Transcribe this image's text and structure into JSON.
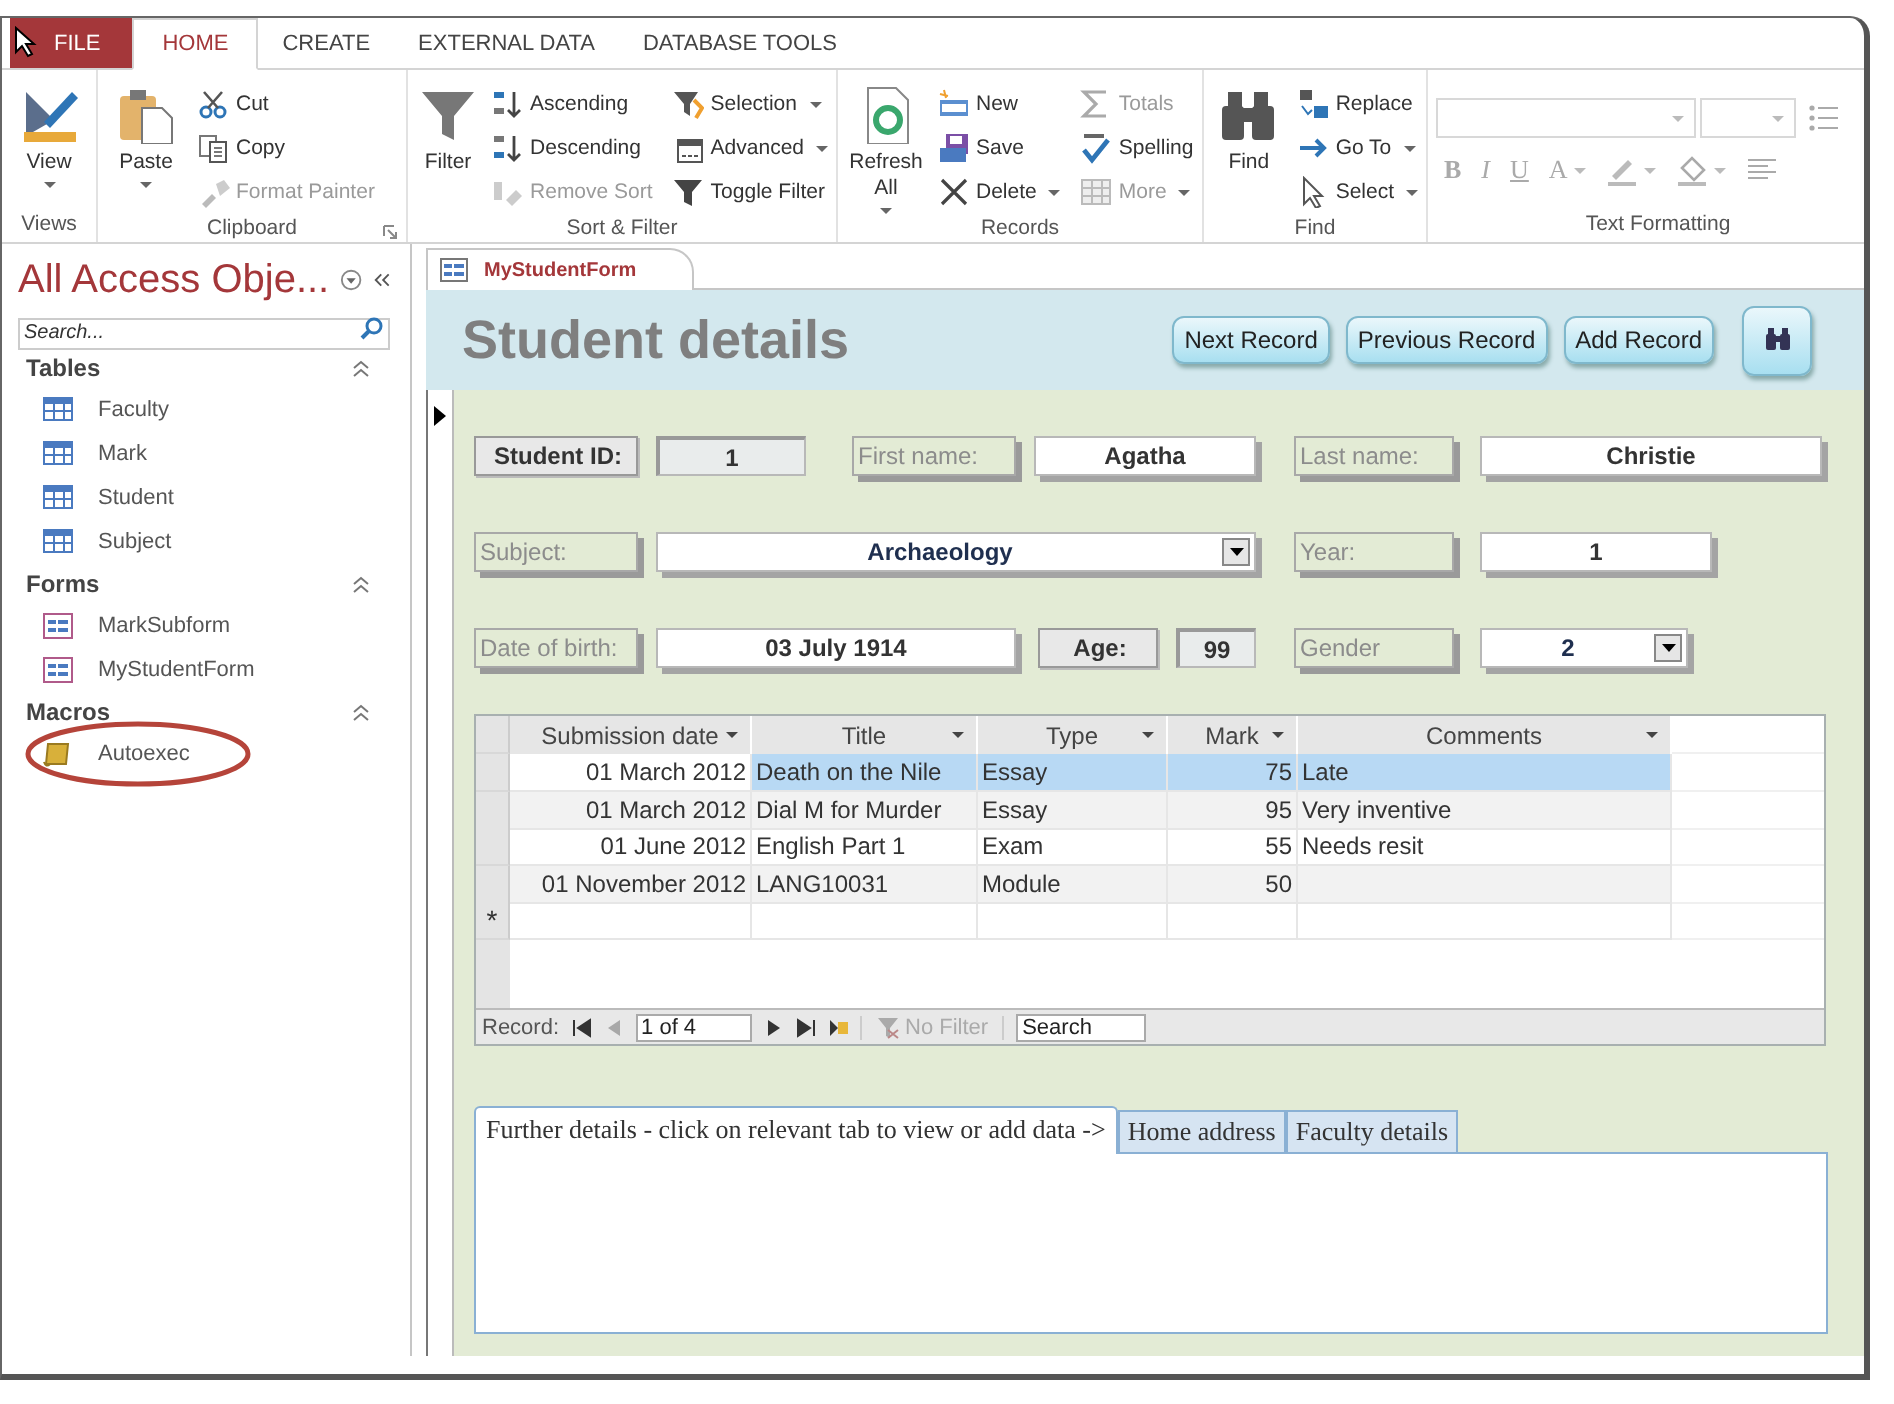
{
  "ribbon": {
    "tabs": [
      {
        "label": "FILE",
        "kind": "file",
        "selected": false
      },
      {
        "label": "HOME",
        "kind": "tab",
        "selected": true
      },
      {
        "label": "CREATE",
        "kind": "tab",
        "selected": false
      },
      {
        "label": "EXTERNAL DATA",
        "kind": "tab",
        "selected": false
      },
      {
        "label": "DATABASE TOOLS",
        "kind": "tab",
        "selected": false
      }
    ],
    "groups": [
      {
        "label": "Views",
        "launcher": false,
        "items": [
          {
            "label": "View",
            "kind": "large",
            "dropdown": true,
            "disabled": false
          }
        ]
      },
      {
        "label": "Clipboard",
        "launcher": true,
        "items": [
          {
            "label": "Paste",
            "kind": "large",
            "dropdown": true,
            "disabled": false
          },
          {
            "label": "Cut",
            "kind": "small",
            "dropdown": false,
            "disabled": false
          },
          {
            "label": "Copy",
            "kind": "small",
            "dropdown": false,
            "disabled": false
          },
          {
            "label": "Format Painter",
            "kind": "small",
            "dropdown": false,
            "disabled": true
          }
        ]
      },
      {
        "label": "Sort & Filter",
        "launcher": false,
        "items": [
          {
            "label": "Filter",
            "kind": "large",
            "dropdown": false,
            "disabled": false
          },
          {
            "label": "Ascending",
            "kind": "small",
            "dropdown": false,
            "disabled": false
          },
          {
            "label": "Descending",
            "kind": "small",
            "dropdown": false,
            "disabled": false
          },
          {
            "label": "Remove Sort",
            "kind": "small",
            "dropdown": false,
            "disabled": true
          },
          {
            "label": "Selection",
            "kind": "small",
            "dropdown": true,
            "disabled": false
          },
          {
            "label": "Advanced",
            "kind": "small",
            "dropdown": true,
            "disabled": false
          },
          {
            "label": "Toggle Filter",
            "kind": "small",
            "dropdown": false,
            "disabled": false
          }
        ]
      },
      {
        "label": "Records",
        "launcher": false,
        "items": [
          {
            "label": "Refresh All",
            "kind": "large",
            "dropdown": true,
            "disabled": false
          },
          {
            "label": "New",
            "kind": "small",
            "dropdown": false,
            "disabled": false
          },
          {
            "label": "Save",
            "kind": "small",
            "dropdown": false,
            "disabled": false
          },
          {
            "label": "Delete",
            "kind": "small",
            "dropdown": true,
            "disabled": false
          },
          {
            "label": "Totals",
            "kind": "small",
            "dropdown": false,
            "disabled": true
          },
          {
            "label": "Spelling",
            "kind": "small",
            "dropdown": false,
            "disabled": false
          },
          {
            "label": "More",
            "kind": "small",
            "dropdown": true,
            "disabled": true
          }
        ]
      },
      {
        "label": "Find",
        "launcher": false,
        "items": [
          {
            "label": "Find",
            "kind": "large",
            "dropdown": false,
            "disabled": false
          },
          {
            "label": "Replace",
            "kind": "small",
            "dropdown": false,
            "disabled": false
          },
          {
            "label": "Go To",
            "kind": "small",
            "dropdown": true,
            "disabled": false
          },
          {
            "label": "Select",
            "kind": "small",
            "dropdown": true,
            "disabled": false
          }
        ]
      },
      {
        "label": "Text Formatting",
        "launcher": false,
        "items": [
          {
            "kind": "combo",
            "disabled": true
          },
          {
            "kind": "combo",
            "disabled": true
          },
          {
            "kind": "icon",
            "dropdown": false,
            "disabled": true
          },
          {
            "kind": "glyph",
            "label": "B",
            "dropdown": false,
            "disabled": true
          },
          {
            "kind": "glyph",
            "label": "I",
            "dropdown": false,
            "disabled": true
          },
          {
            "kind": "glyph",
            "label": "U",
            "dropdown": false,
            "disabled": true
          },
          {
            "kind": "glyph",
            "label": "A",
            "dropdown": true,
            "disabled": true
          },
          {
            "kind": "icon",
            "dropdown": true,
            "disabled": true
          },
          {
            "kind": "icon",
            "dropdown": true,
            "disabled": true
          },
          {
            "kind": "icon",
            "dropdown": false,
            "disabled": true
          }
        ]
      }
    ]
  },
  "navigation_pane": {
    "title": "All Access Obje...",
    "search": {
      "placeholder": "Search..."
    },
    "groups": [
      {
        "label": "Tables",
        "kind": "table",
        "expanded": true,
        "items": [
          {
            "label": "Faculty",
            "highlighted": false
          },
          {
            "label": "Mark",
            "highlighted": false
          },
          {
            "label": "Student",
            "highlighted": false
          },
          {
            "label": "Subject",
            "highlighted": false
          }
        ]
      },
      {
        "label": "Forms",
        "kind": "form",
        "expanded": true,
        "items": [
          {
            "label": "MarkSubform",
            "highlighted": false
          },
          {
            "label": "MyStudentForm",
            "highlighted": false
          }
        ]
      },
      {
        "label": "Macros",
        "kind": "macro",
        "expanded": true,
        "items": [
          {
            "label": "Autoexec",
            "highlighted": true
          }
        ]
      }
    ]
  },
  "document_tabs": [
    {
      "label": "MyStudentForm",
      "selected": true
    }
  ],
  "form": {
    "title": "Student details",
    "header_buttons": [
      {
        "kind": "text",
        "label": "Next Record"
      },
      {
        "kind": "text",
        "label": "Previous Record"
      },
      {
        "kind": "text",
        "label": "Add Record"
      },
      {
        "kind": "search"
      }
    ],
    "field_rows": [
      [
        {
          "label": "Student ID:",
          "value": "1",
          "kind": "text",
          "locked": true
        },
        {
          "label": "First name:",
          "value": "Agatha",
          "kind": "text",
          "locked": false
        },
        {
          "label": "Last name:",
          "value": "Christie",
          "kind": "text",
          "locked": false
        }
      ],
      [
        {
          "label": "Subject:",
          "value": "Archaeology",
          "kind": "combo",
          "locked": false
        },
        {
          "label": "Year:",
          "value": "1",
          "kind": "text",
          "locked": false
        }
      ],
      [
        {
          "label": "Date of birth:",
          "value": "03 July 1914",
          "kind": "text",
          "locked": false
        },
        {
          "label": "Age:",
          "value": "99",
          "kind": "text",
          "locked": true
        },
        {
          "label": "Gender",
          "value": "2",
          "kind": "combo",
          "locked": false
        }
      ]
    ],
    "subform": {
      "columns": [
        {
          "label": "Submission date"
        },
        {
          "label": "Title"
        },
        {
          "label": "Type"
        },
        {
          "label": "Mark"
        },
        {
          "label": "Comments"
        }
      ],
      "rows": [
        {
          "selected": true,
          "cells": [
            "01 March 2012",
            "Death on the Nile",
            "Essay",
            "75",
            "Late"
          ]
        },
        {
          "selected": false,
          "cells": [
            "01 March 2012",
            "Dial M for Murder",
            "Essay",
            "95",
            "Very inventive"
          ]
        },
        {
          "selected": false,
          "cells": [
            "01 June 2012",
            "English Part 1",
            "Exam",
            "55",
            "Needs resit"
          ]
        },
        {
          "selected": false,
          "cells": [
            "01 November 2012",
            "LANG10031",
            "Module",
            "50"
          ]
        }
      ],
      "new_row_marker": "*",
      "navigator": {
        "label": "Record:",
        "position": "1 of 4",
        "buttons": [
          {
            "kind": "first",
            "disabled": false
          },
          {
            "kind": "previous",
            "disabled": true
          },
          {
            "kind": "next",
            "disabled": false
          },
          {
            "kind": "last",
            "disabled": false
          },
          {
            "kind": "new",
            "disabled": false
          }
        ],
        "filter": {
          "label": "No Filter",
          "disabled": true
        },
        "search": {
          "placeholder": "Search"
        }
      }
    },
    "tab_control": {
      "tabs": [
        {
          "label": "Further details - click on relevant tab to view or add data ->",
          "selected": true
        },
        {
          "label": "Home address",
          "selected": false
        },
        {
          "label": "Faculty details",
          "selected": false
        }
      ]
    }
  }
}
